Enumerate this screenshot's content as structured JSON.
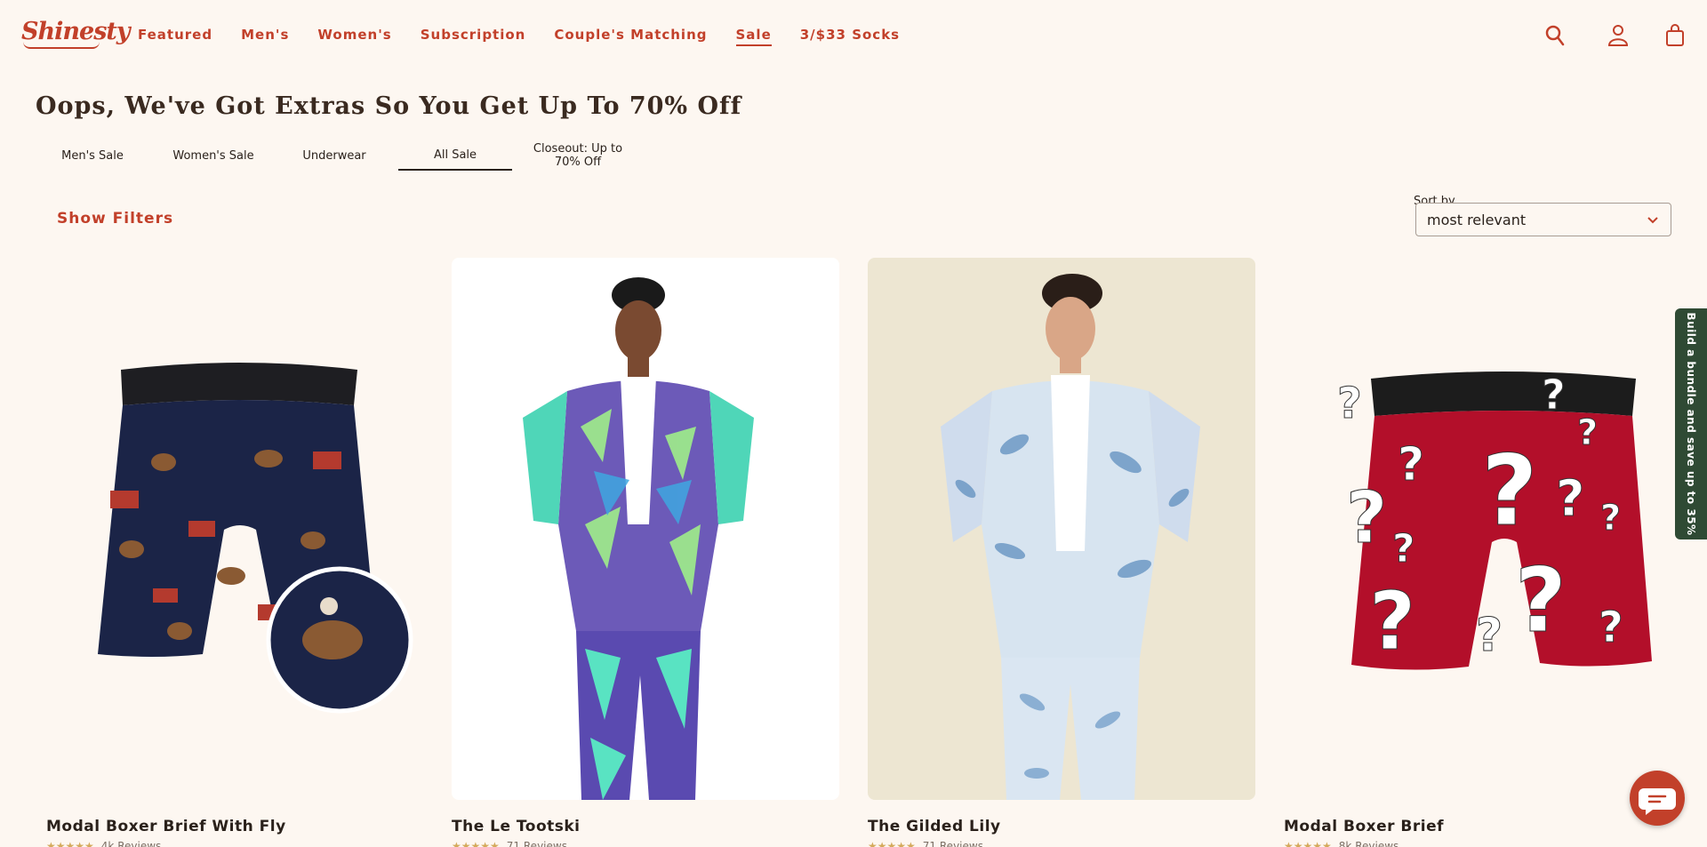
{
  "header": {
    "logo": "Shinesty",
    "nav": [
      {
        "label": "Featured",
        "active": false
      },
      {
        "label": "Men's",
        "active": false
      },
      {
        "label": "Women's",
        "active": false
      },
      {
        "label": "Subscription",
        "active": false
      },
      {
        "label": "Couple's Matching",
        "active": false
      },
      {
        "label": "Sale",
        "active": true
      },
      {
        "label": "3/$33 Socks",
        "active": false
      }
    ],
    "icons": [
      "search-icon",
      "account-icon",
      "cart-icon"
    ]
  },
  "page": {
    "title": "Oops, We've Got Extras So You Get Up To 70% Off",
    "tabs": [
      {
        "label": "Men's Sale",
        "active": false
      },
      {
        "label": "Women's Sale",
        "active": false
      },
      {
        "label": "Underwear",
        "active": false
      },
      {
        "label": "All Sale",
        "active": true
      },
      {
        "label": "Closeout: Up to 70% Off",
        "active": false
      }
    ]
  },
  "filters": {
    "show_label": "Show Filters",
    "sort_label": "Sort by",
    "sort_value": "most relevant"
  },
  "products": [
    {
      "name": "Modal Boxer Brief With Fly",
      "stars": "★★★★★",
      "reviews": "4k Reviews"
    },
    {
      "name": "The Le Tootski",
      "stars": "★★★★★",
      "reviews": "71 Reviews"
    },
    {
      "name": "The Gilded Lily",
      "stars": "★★★★★",
      "reviews": "71 Reviews"
    },
    {
      "name": "Modal Boxer Brief",
      "stars": "★★★★★",
      "reviews": "8k Reviews"
    }
  ],
  "bundle_tab": "Build a bundle and save up to 35%",
  "colors": {
    "accent": "#c2402a",
    "background": "#fdf7f1",
    "bundle_green": "#2f4a34"
  }
}
